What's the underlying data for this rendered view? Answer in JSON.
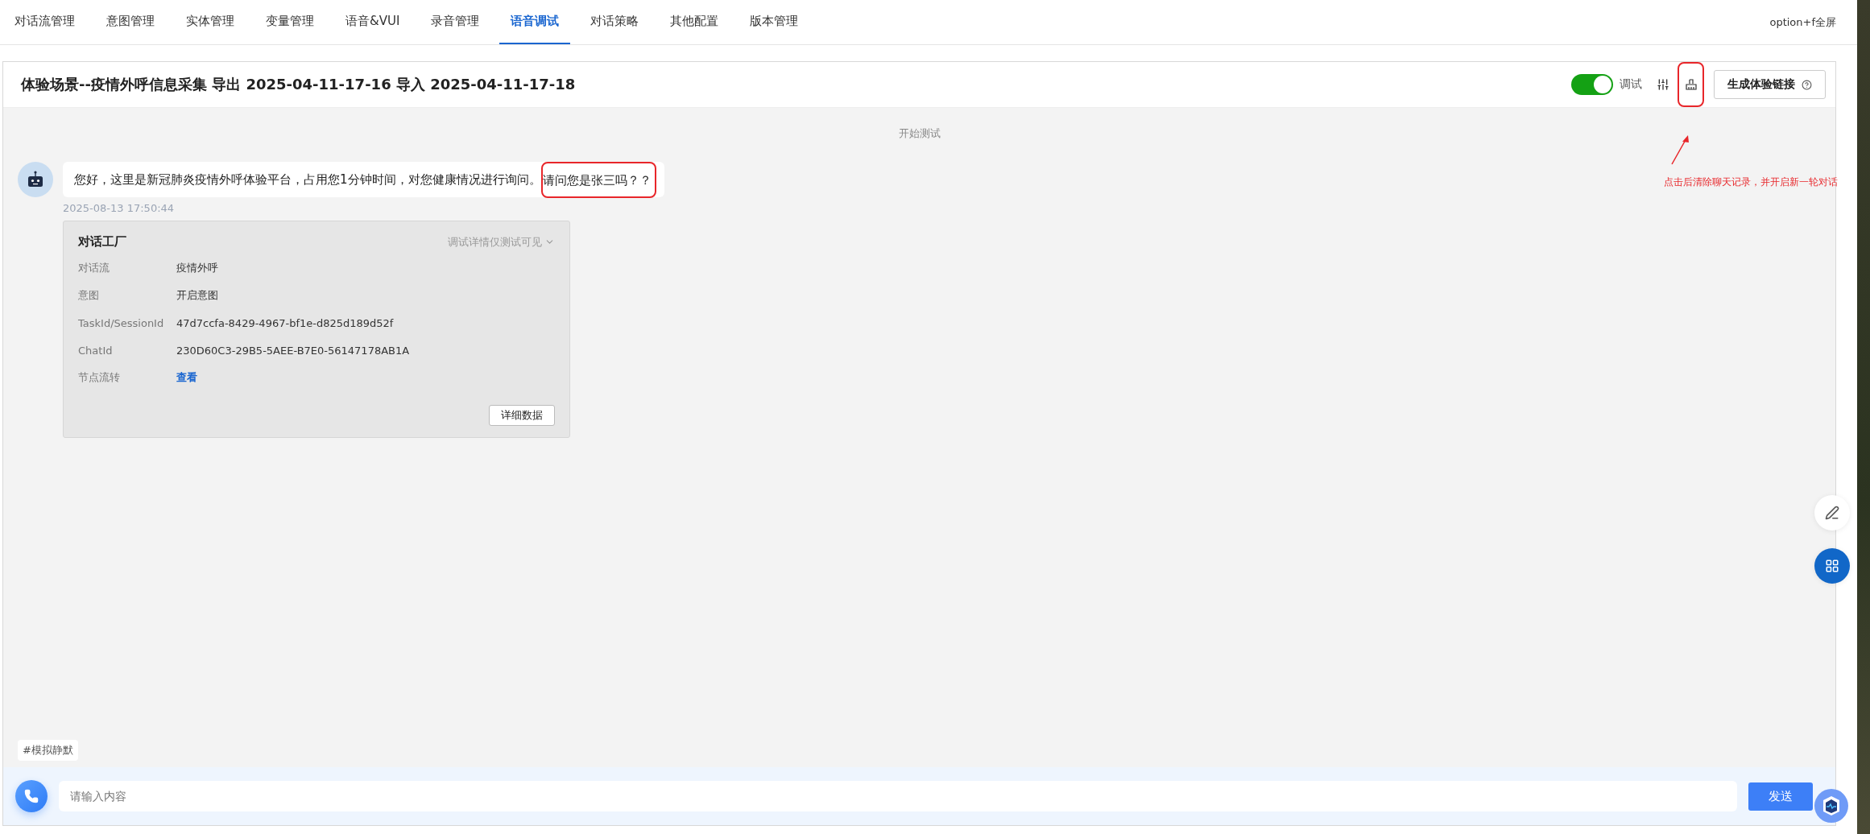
{
  "nav": {
    "tabs": [
      {
        "label": "对话流管理",
        "selected": false
      },
      {
        "label": "意图管理",
        "selected": false
      },
      {
        "label": "实体管理",
        "selected": false
      },
      {
        "label": "变量管理",
        "selected": false
      },
      {
        "label": "语音&VUI",
        "selected": false
      },
      {
        "label": "录音管理",
        "selected": false
      },
      {
        "label": "语音调试",
        "selected": true
      },
      {
        "label": "对话策略",
        "selected": false
      },
      {
        "label": "其他配置",
        "selected": false
      },
      {
        "label": "版本管理",
        "selected": false
      }
    ],
    "shortcut_hint": "option+f全屏"
  },
  "panel": {
    "title": "体验场景--疫情外呼信息采集 导出 2025-04-11-17-16 导入 2025-04-11-17-18",
    "debug_toggle": {
      "label": "调试",
      "on": true
    },
    "share_button": {
      "label": "生成体验链接"
    }
  },
  "annotation": {
    "note": "点击后清除聊天记录，并开启新一轮对话"
  },
  "chat": {
    "start_label": "开始测试",
    "messages": [
      {
        "text": "您好，这里是新冠肺炎疫情外呼体验平台，占用您1分钟时间，对您健康情况进行询问。",
        "highlight": "请问您是张三吗？？",
        "time": "2025-08-13 17:50:44",
        "debug_card": {
          "title": "对话工厂",
          "hint": "调试详情仅测试可见",
          "rows": [
            {
              "label": "对话流",
              "value": "疫情外呼",
              "kind": "text"
            },
            {
              "label": "意图",
              "value": "开启意图",
              "kind": "text"
            },
            {
              "label": "TaskId/SessionId",
              "value": "47d7ccfa-8429-4967-bf1e-d825d189d52f",
              "kind": "text"
            },
            {
              "label": "ChatId",
              "value": "230D60C3-29B5-5AEE-B7E0-56147178AB1A",
              "kind": "text"
            },
            {
              "label": "节点流转",
              "value": "查看",
              "kind": "link"
            }
          ],
          "detail_button": "详细数据"
        }
      }
    ]
  },
  "quick_tags": [
    "#模拟静默"
  ],
  "composer": {
    "placeholder": "请输入内容",
    "send_label": "发送"
  }
}
